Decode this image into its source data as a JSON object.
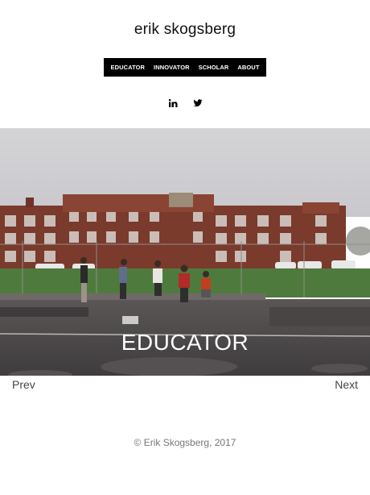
{
  "site": {
    "title": "erik skogsberg"
  },
  "nav": {
    "items": [
      {
        "label": "EDUCATOR"
      },
      {
        "label": "INNOVATOR"
      },
      {
        "label": "SCHOLAR"
      },
      {
        "label": "ABOUT"
      }
    ]
  },
  "social": [
    {
      "icon": "linkedin-icon",
      "label": "in"
    },
    {
      "icon": "twitter-icon"
    }
  ],
  "hero": {
    "caption": "EDUCATOR",
    "image": "photo of skateboarders on an outdoor court in front of a brick school building"
  },
  "pager": {
    "prev": "Prev",
    "next": "Next"
  },
  "footer": {
    "text": "© Erik Skogsberg, 2017"
  },
  "colors": {
    "nav_bg": "#000000",
    "text": "#111111",
    "footer": "#777777"
  }
}
